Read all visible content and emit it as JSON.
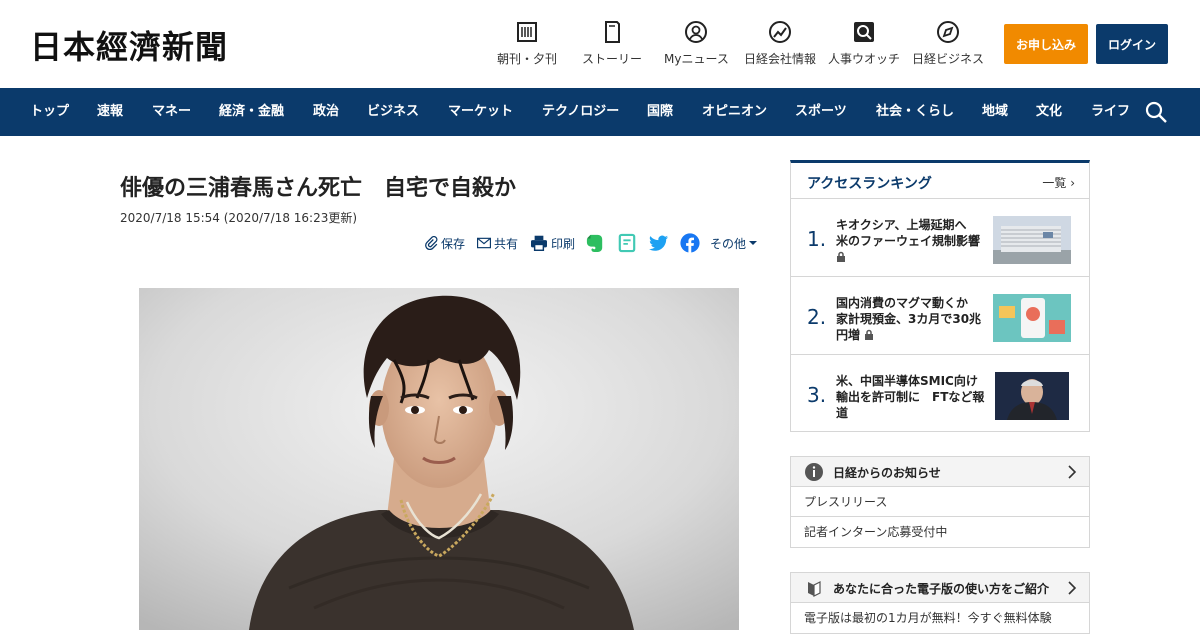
{
  "header": {
    "logo": "日本經濟新聞",
    "nav": [
      {
        "label": "朝刊・夕刊",
        "icon": "newspaper-icon"
      },
      {
        "label": "ストーリー",
        "icon": "book-icon"
      },
      {
        "label": "Myニュース",
        "icon": "user-icon"
      },
      {
        "label": "日経会社情報",
        "icon": "chart-icon"
      },
      {
        "label": "人事ウオッチ",
        "icon": "search-person-icon"
      },
      {
        "label": "日経ビジネス",
        "icon": "compass-icon"
      }
    ],
    "subscribe_label": "お申し込み",
    "login_label": "ログイン"
  },
  "navbar": {
    "items": [
      "トップ",
      "速報",
      "マネー",
      "経済・金融",
      "政治",
      "ビジネス",
      "マーケット",
      "テクノロジー",
      "国際",
      "オピニオン",
      "スポーツ",
      "社会・くらし",
      "地域",
      "文化",
      "ライフ"
    ]
  },
  "article": {
    "title": "俳優の三浦春馬さん死亡　自宅で自殺か",
    "date": "2020/7/18 15:54 (2020/7/18 16:23更新)",
    "share": {
      "save": "保存",
      "share": "共有",
      "print": "印刷",
      "more": "その他"
    }
  },
  "ranking": {
    "title": "アクセスランキング",
    "more": "一覧",
    "items": [
      {
        "rank": "1.",
        "text": "キオクシア、上場延期へ　米のファーウェイ規制影響"
      },
      {
        "rank": "2.",
        "text": "国内消費のマグマ動くか　家計現預金、3カ月で30兆円増"
      },
      {
        "rank": "3.",
        "text": "米、中国半導体SMIC向け輸出を許可制に　FTなど報道"
      }
    ]
  },
  "notice": {
    "title": "日経からのお知らせ",
    "items": [
      "プレスリリース",
      "記者インターン応募受付中"
    ]
  },
  "guide": {
    "title": "あなたに合った電子版の使い方をご紹介",
    "items": [
      "電子版は最初の1カ月が無料！今すぐ無料体験"
    ]
  },
  "colors": {
    "brand_navy": "#0b3a6b",
    "subscribe_orange": "#f18a00"
  }
}
